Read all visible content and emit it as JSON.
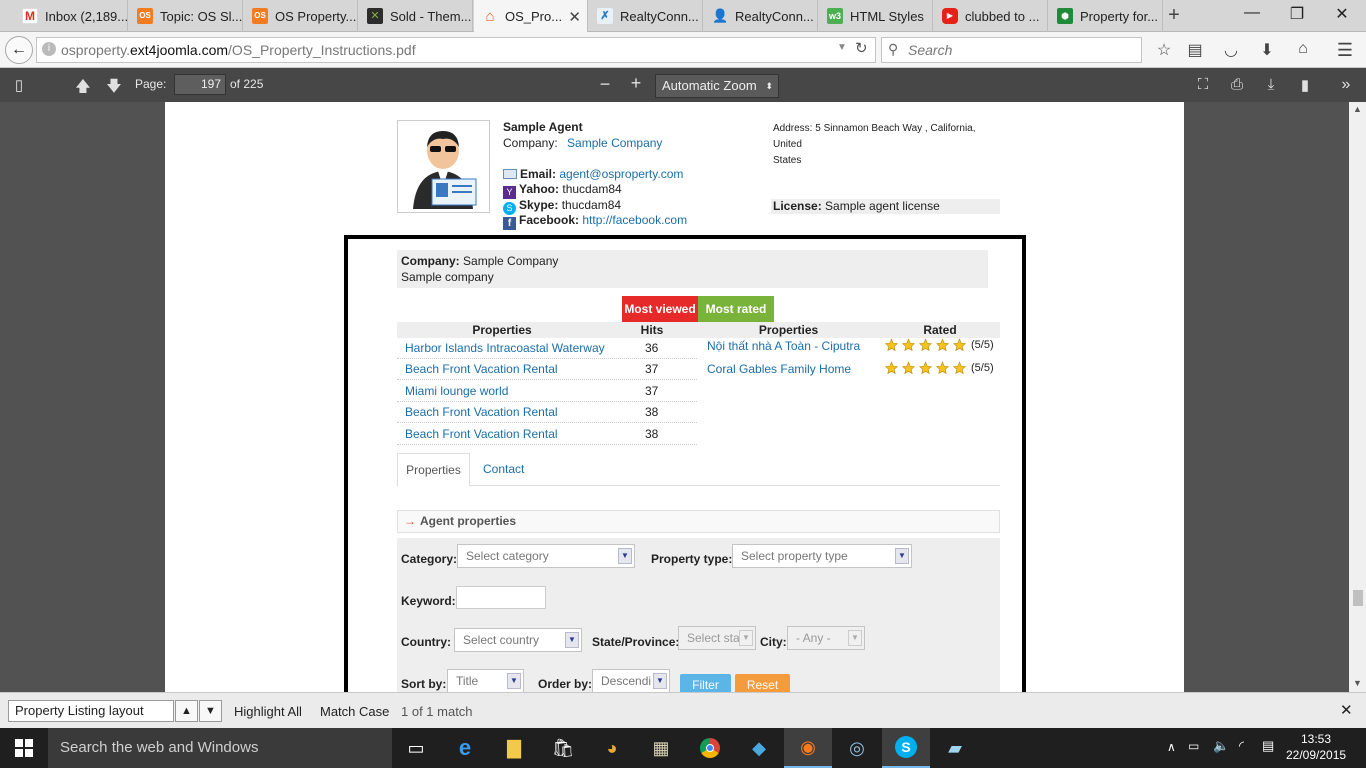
{
  "browser": {
    "tabs": [
      {
        "label": "Inbox (2,189...",
        "icon": "gmail-icon",
        "color": "#d93025"
      },
      {
        "label": "Topic: OS Sl...",
        "icon": "os-icon",
        "color": "#f47c20"
      },
      {
        "label": "OS Property...",
        "icon": "os-icon",
        "color": "#f47c20"
      },
      {
        "label": "Sold - Them...",
        "icon": "themeforest-icon",
        "color": "#82b440"
      },
      {
        "label": "OS_Pro...",
        "icon": "home-icon",
        "color": "#e0622e",
        "active": true
      },
      {
        "label": "RealtyConn...",
        "icon": "realty-icon",
        "color": "#2a7cc7"
      },
      {
        "label": "RealtyConn...",
        "icon": "person-icon",
        "color": "#3b73b9"
      },
      {
        "label": "HTML Styles",
        "icon": "w3-icon",
        "color": "#4caf50"
      },
      {
        "label": "clubbed to ...",
        "icon": "youtube-icon",
        "color": "#e62117"
      },
      {
        "label": "Property for...",
        "icon": "zillow-icon",
        "color": "#1f8a3a"
      }
    ],
    "url_domain_prefix": "osproperty.",
    "url_domain": "ext4joomla.com",
    "url_path": "/OS_Property_Instructions.pdf",
    "search_placeholder": "Search"
  },
  "pdf_toolbar": {
    "page_label": "Page:",
    "page_value": "197",
    "page_total": "of 225",
    "zoom": "Automatic Zoom"
  },
  "agent": {
    "name": "Sample Agent",
    "company_label": "Company:",
    "company": "Sample Company",
    "email_label": "Email:",
    "email": "agent@osproperty.com",
    "yahoo_label": "Yahoo:",
    "yahoo": "thucdam84",
    "skype_label": "Skype:",
    "skype": "thucdam84",
    "facebook_label": "Facebook:",
    "facebook": "http://facebook.com",
    "address_line1": "Address: 5 Sinnamon Beach Way , California, United",
    "address_line2": "States",
    "license_label": "License:",
    "license": "Sample agent license"
  },
  "company_box": {
    "label": "Company:",
    "name": "Sample Company",
    "description": "Sample company"
  },
  "stat_tabs": {
    "most_viewed": "Most viewed",
    "most_rated": "Most rated"
  },
  "most_viewed": {
    "col_properties": "Properties",
    "col_hits": "Hits",
    "rows": [
      {
        "name": "Harbor Islands Intracoastal Waterway",
        "hits": "36"
      },
      {
        "name": "Beach Front Vacation Rental",
        "hits": "37"
      },
      {
        "name": "Miami lounge world",
        "hits": "37"
      },
      {
        "name": "Beach Front Vacation Rental",
        "hits": "38"
      },
      {
        "name": "Beach Front Vacation Rental",
        "hits": "38"
      }
    ]
  },
  "most_rated": {
    "col_properties": "Properties",
    "col_rated": "Rated",
    "rows": [
      {
        "name": "Nội thất nhà A Toàn - Ciputra",
        "stars": 5,
        "score": "(5/5)"
      },
      {
        "name": "Coral Gables Family Home",
        "stars": 5,
        "score": "(5/5)"
      }
    ]
  },
  "content_tabs": {
    "properties": "Properties",
    "contact": "Contact"
  },
  "agent_properties": {
    "heading": "Agent properties",
    "category_label": "Category:",
    "category_value": "Select category",
    "property_type_label": "Property type:",
    "property_type_value": "Select property type",
    "keyword_label": "Keyword:",
    "keyword_value": "",
    "country_label": "Country:",
    "country_value": "Select country",
    "state_label": "State/Province:",
    "state_value": "Select sta",
    "city_label": "City:",
    "city_value": "- Any -",
    "sort_label": "Sort by:",
    "sort_value": "Title",
    "order_label": "Order by:",
    "order_value": "Descendi",
    "filter_button": "Filter",
    "reset_button": "Reset"
  },
  "findbar": {
    "query": "Property Listing layout",
    "highlight_all": "Highlight All",
    "match_case": "Match Case",
    "match_status": "1 of 1 match"
  },
  "taskbar": {
    "search_placeholder": "Search the web and Windows",
    "time": "13:53",
    "date": "22/09/2015"
  },
  "colors": {
    "most_viewed_bg": "#e62a2a",
    "most_rated_bg": "#7ab33a",
    "link": "#1a6ea8",
    "filter_bg": "#5bb5e6",
    "reset_bg": "#f49b3b",
    "pdf_toolbar_bg": "#474747",
    "viewer_bg": "#525252"
  }
}
